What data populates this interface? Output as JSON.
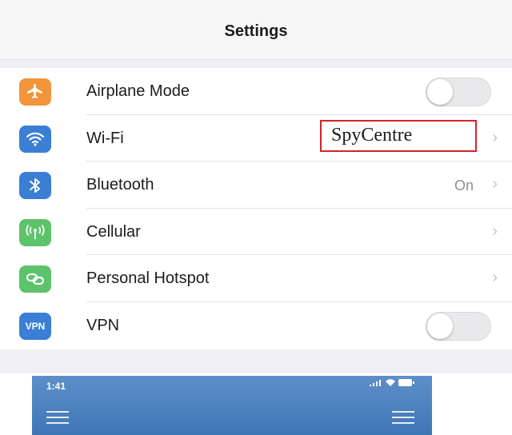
{
  "header": {
    "title": "Settings"
  },
  "settings": {
    "items": [
      {
        "label": "Airplane Mode",
        "icon": "airplane-icon",
        "icon_color": "#f1943a",
        "control": "toggle",
        "toggle_on": false
      },
      {
        "label": "Wi-Fi",
        "icon": "wifi-icon",
        "icon_color": "#3a7fd5",
        "control": "network",
        "value": "SpyCentre"
      },
      {
        "label": "Bluetooth",
        "icon": "bluetooth-icon",
        "icon_color": "#3a7fd5",
        "control": "detail",
        "value": "On"
      },
      {
        "label": "Cellular",
        "icon": "cellular-icon",
        "icon_color": "#5cc36a",
        "control": "chevron"
      },
      {
        "label": "Personal Hotspot",
        "icon": "hotspot-icon",
        "icon_color": "#5cc36a",
        "control": "chevron"
      },
      {
        "label": "VPN",
        "icon": "vpn-icon",
        "icon_color": "#3a7fd5",
        "icon_text": "VPN",
        "control": "toggle",
        "toggle_on": false
      }
    ]
  },
  "phone_preview": {
    "time": "1:41",
    "background": "#4a7fbd"
  },
  "highlight_color": "#d3232d"
}
